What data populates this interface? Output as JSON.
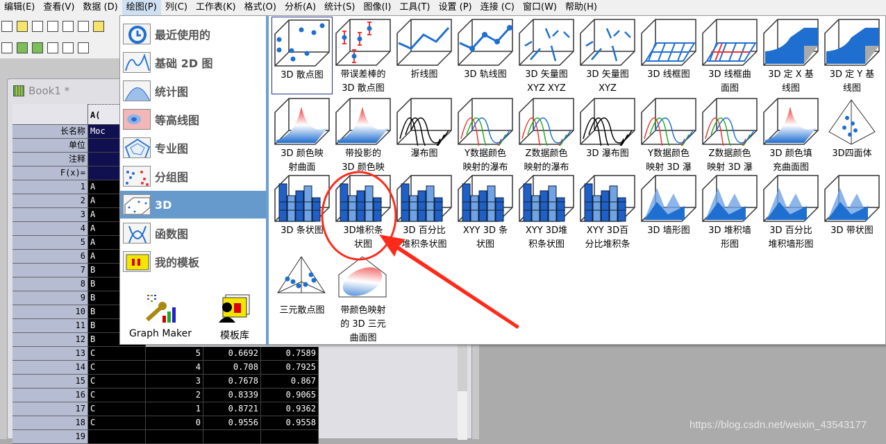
{
  "menu": [
    "编辑(E)",
    "查看(V)",
    "数据 (D)",
    "绘图(P)",
    "列(C)",
    "工作表(K)",
    "格式(O)",
    "分析(A)",
    "统计(S)",
    "图像(I)",
    "工具(T)",
    "设置 (P)",
    "连接 (C)",
    "窗口(W)",
    "帮助(H)"
  ],
  "active_menu": 3,
  "book": {
    "title": "Book1 *"
  },
  "worksheet": {
    "col_header": "A(",
    "meta_rows": [
      {
        "label": "长名称",
        "a": "Moc"
      },
      {
        "label": "单位",
        "a": ""
      },
      {
        "label": "注释",
        "a": ""
      },
      {
        "label": "F(x)=",
        "a": ""
      }
    ],
    "rows": [
      {
        "n": "1",
        "a": "A"
      },
      {
        "n": "2",
        "a": "A"
      },
      {
        "n": "3",
        "a": "A"
      },
      {
        "n": "4",
        "a": "A"
      },
      {
        "n": "5",
        "a": "A"
      },
      {
        "n": "6",
        "a": "A"
      },
      {
        "n": "7",
        "a": "B"
      },
      {
        "n": "8",
        "a": "B"
      },
      {
        "n": "9",
        "a": "B"
      },
      {
        "n": "10",
        "a": "B"
      },
      {
        "n": "11",
        "a": "B"
      },
      {
        "n": "12",
        "a": "B"
      },
      {
        "n": "13",
        "a": "C",
        "b": "5",
        "c": "0.6692",
        "d": "0.7589"
      },
      {
        "n": "14",
        "a": "C",
        "b": "4",
        "c": "0.708",
        "d": "0.7925"
      },
      {
        "n": "15",
        "a": "C",
        "b": "3",
        "c": "0.7678",
        "d": "0.867"
      },
      {
        "n": "16",
        "a": "C",
        "b": "2",
        "c": "0.8339",
        "d": "0.9065"
      },
      {
        "n": "17",
        "a": "C",
        "b": "1",
        "c": "0.8721",
        "d": "0.9362"
      },
      {
        "n": "18",
        "a": "C",
        "b": "0",
        "c": "0.9556",
        "d": "0.9558"
      },
      {
        "n": "19",
        "a": ""
      }
    ]
  },
  "categories": [
    {
      "label": "最近使用的",
      "icon": "clock-icon"
    },
    {
      "label": "基础 2D 图",
      "icon": "line-2d-icon"
    },
    {
      "label": "统计图",
      "icon": "histogram-icon"
    },
    {
      "label": "等高线图",
      "icon": "contour-icon"
    },
    {
      "label": "专业图",
      "icon": "radar-icon"
    },
    {
      "label": "分组图",
      "icon": "group-scatter-icon"
    },
    {
      "label": "3D",
      "icon": "cube-3d-icon"
    },
    {
      "label": "函数图",
      "icon": "function-icon"
    },
    {
      "label": "我的模板",
      "icon": "template-icon"
    }
  ],
  "selected_category": 6,
  "graph_maker": "Graph Maker",
  "template_library": "模板库",
  "gallery": [
    {
      "label": "3D 散点图",
      "icon": "dots"
    },
    {
      "label": "带误差棒的\n3D 散点图",
      "icon": "errdots"
    },
    {
      "label": "折线图",
      "icon": "line"
    },
    {
      "label": "3D 轨线图",
      "icon": "traj"
    },
    {
      "label": "3D 矢量图\nXYZ XYZ",
      "icon": "vector"
    },
    {
      "label": "3D 矢量图\nXYZ",
      "icon": "vector"
    },
    {
      "label": "3D 线框图",
      "icon": "wire"
    },
    {
      "label": "3D 线框曲\n面图",
      "icon": "wirered"
    },
    {
      "label": "3D 定 X 基\n线图",
      "icon": "ribbon"
    },
    {
      "label": "3D 定 Y 基\n线图",
      "icon": "ribbon"
    },
    {
      "label": "3D 颜色映\n射曲面",
      "icon": "surface"
    },
    {
      "label": "带投影的\n3D 颜色映",
      "icon": "surface"
    },
    {
      "label": "瀑布图",
      "icon": "waterfall"
    },
    {
      "label": "Y数据颜色\n映射的瀑布",
      "icon": "waterfallc"
    },
    {
      "label": "Z数据颜色\n映射的瀑布",
      "icon": "waterfallc"
    },
    {
      "label": "3D 瀑布图",
      "icon": "waterfall"
    },
    {
      "label": "Y数据颜色\n映射 3D 瀑",
      "icon": "waterfallc"
    },
    {
      "label": "Z数据颜色\n映射 3D 瀑",
      "icon": "waterfallc"
    },
    {
      "label": "3D 颜色填\n充曲面图",
      "icon": "fillsurf"
    },
    {
      "label": "3D四面体",
      "icon": "tetra"
    },
    {
      "label": "3D 条状图",
      "icon": "bars"
    },
    {
      "label": "3D堆积条\n状图",
      "icon": "bars"
    },
    {
      "label": "3D 百分比\n堆积条状图",
      "icon": "bars"
    },
    {
      "label": "XYY 3D 条\n状图",
      "icon": "bars"
    },
    {
      "label": "XYY 3D堆\n积条状图",
      "icon": "bars"
    },
    {
      "label": "XYY 3D百\n分比堆积条",
      "icon": "bars"
    },
    {
      "label": "3D 墙形图",
      "icon": "wall"
    },
    {
      "label": "3D 堆积墙\n形图",
      "icon": "wall"
    },
    {
      "label": "3D 百分比\n堆积墙形图",
      "icon": "wall"
    },
    {
      "label": "3D 带状图",
      "icon": "wall"
    },
    {
      "label": "三元散点图",
      "icon": "ternary"
    },
    {
      "label": "带颜色映射\n的 3D 三元\n曲面图",
      "icon": "ternsurf"
    }
  ],
  "selected_tile": 0,
  "highlighted_tile": 21,
  "annotation_color": "#ff2a1a",
  "accent": "#6699cc",
  "watermark": "https://blog.csdn.net/weixin_43543177"
}
